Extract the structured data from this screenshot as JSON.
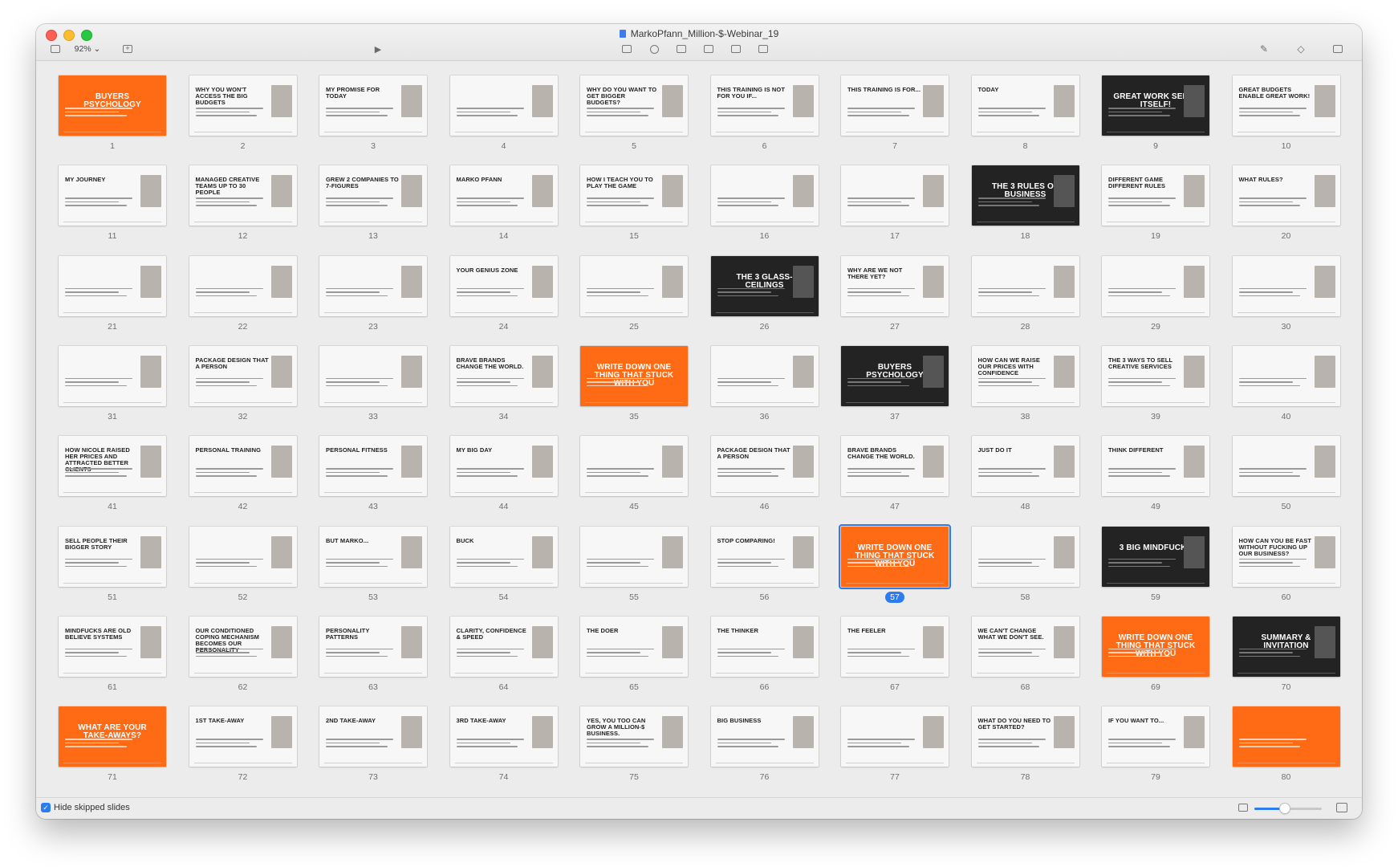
{
  "window": {
    "title": "MarkoPfann_Million-$-Webinar_19",
    "zoom_label": "92% ⌄"
  },
  "bottombar": {
    "hide_skipped_label": "Hide skipped slides",
    "hide_skipped_checked": true,
    "thumb_size_fraction": 0.45
  },
  "selected_slide": 57,
  "slides": [
    {
      "n": "1",
      "style": "orange",
      "title": "BUYERS PSYCHOLOGY"
    },
    {
      "n": "2",
      "style": "light",
      "title": "WHY YOU WON'T ACCESS THE BIG BUDGETS"
    },
    {
      "n": "3",
      "style": "light",
      "title": "MY PROMISE FOR TODAY"
    },
    {
      "n": "4",
      "style": "light",
      "title": ""
    },
    {
      "n": "5",
      "style": "light",
      "title": "WHY DO YOU WANT TO GET BIGGER BUDGETS?"
    },
    {
      "n": "6",
      "style": "light",
      "title": "THIS TRAINING IS NOT FOR YOU IF..."
    },
    {
      "n": "7",
      "style": "light",
      "title": "THIS TRAINING IS FOR..."
    },
    {
      "n": "8",
      "style": "light",
      "title": "TODAY"
    },
    {
      "n": "9",
      "style": "dark",
      "title": "GREAT WORK SELLS ITSELF!"
    },
    {
      "n": "10",
      "style": "light",
      "title": "GREAT BUDGETS ENABLE GREAT WORK!"
    },
    {
      "n": "11",
      "style": "light",
      "title": "MY JOURNEY"
    },
    {
      "n": "12",
      "style": "light",
      "title": "Managed creative teams up to 30 people"
    },
    {
      "n": "13",
      "style": "light",
      "title": "GREW 2 COMPANIES TO 7-FIGURES"
    },
    {
      "n": "14",
      "style": "light",
      "title": "MARKO PFANN"
    },
    {
      "n": "15",
      "style": "light",
      "title": "HOW I TEACH YOU TO PLAY THE GAME"
    },
    {
      "n": "16",
      "style": "light",
      "title": ""
    },
    {
      "n": "17",
      "style": "light",
      "title": ""
    },
    {
      "n": "18",
      "style": "dark",
      "title": "THE 3 RULES OF BUSINESS"
    },
    {
      "n": "19",
      "style": "light",
      "title": "DIFFERENT GAME DIFFERENT RULES"
    },
    {
      "n": "20",
      "style": "light",
      "title": "WHAT RULES?"
    },
    {
      "n": "21",
      "style": "light",
      "title": ""
    },
    {
      "n": "22",
      "style": "light",
      "title": ""
    },
    {
      "n": "23",
      "style": "light",
      "title": ""
    },
    {
      "n": "24",
      "style": "light",
      "title": "YOUR GENIUS ZONE"
    },
    {
      "n": "25",
      "style": "light",
      "title": ""
    },
    {
      "n": "26",
      "style": "dark",
      "title": "THE 3 GLASS-CEILINGS"
    },
    {
      "n": "27",
      "style": "light",
      "title": "WHY ARE WE NOT THERE YET?"
    },
    {
      "n": "28",
      "style": "light",
      "title": ""
    },
    {
      "n": "29",
      "style": "light",
      "title": ""
    },
    {
      "n": "30",
      "style": "light",
      "title": ""
    },
    {
      "n": "31",
      "style": "light",
      "title": ""
    },
    {
      "n": "32",
      "style": "light",
      "title": "Package design that a person"
    },
    {
      "n": "33",
      "style": "light",
      "title": ""
    },
    {
      "n": "34",
      "style": "light",
      "title": "Brave brands change the world."
    },
    {
      "n": "35",
      "style": "orange",
      "title": "WRITE DOWN ONE THING THAT STUCK WITH YOU"
    },
    {
      "n": "36",
      "style": "light",
      "title": ""
    },
    {
      "n": "37",
      "style": "dark",
      "title": "BUYERS PSYCHOLOGY"
    },
    {
      "n": "38",
      "style": "light",
      "title": "HOW CAN WE RAISE OUR PRICES WITH CONFIDENCE"
    },
    {
      "n": "39",
      "style": "light",
      "title": "THE 3 WAYS TO SELL CREATIVE SERVICES"
    },
    {
      "n": "40",
      "style": "light",
      "title": ""
    },
    {
      "n": "41",
      "style": "light",
      "title": "HOW NICOLE RAISED HER PRICES AND ATTRACTED BETTER CLIENTS"
    },
    {
      "n": "42",
      "style": "light",
      "title": "Personal Training"
    },
    {
      "n": "43",
      "style": "light",
      "title": "PERSONAL FITNESS"
    },
    {
      "n": "44",
      "style": "light",
      "title": "MY BIG DAY"
    },
    {
      "n": "45",
      "style": "light",
      "title": ""
    },
    {
      "n": "46",
      "style": "light",
      "title": "Package design that a person"
    },
    {
      "n": "47",
      "style": "light",
      "title": "Brave brands change the world."
    },
    {
      "n": "48",
      "style": "light",
      "title": "JUST DO IT"
    },
    {
      "n": "49",
      "style": "light",
      "title": "THINK DIFFERENT"
    },
    {
      "n": "50",
      "style": "light",
      "title": ""
    },
    {
      "n": "51",
      "style": "light",
      "title": "Sell people their bigger story"
    },
    {
      "n": "52",
      "style": "light",
      "title": ""
    },
    {
      "n": "53",
      "style": "light",
      "title": "BUT MARKO..."
    },
    {
      "n": "54",
      "style": "light",
      "title": "BUCK"
    },
    {
      "n": "55",
      "style": "light",
      "title": ""
    },
    {
      "n": "56",
      "style": "light",
      "title": "STOP COMPARING!"
    },
    {
      "n": "57",
      "style": "orange",
      "title": "WRITE DOWN ONE THING THAT STUCK WITH YOU"
    },
    {
      "n": "58",
      "style": "light",
      "title": ""
    },
    {
      "n": "59",
      "style": "dark",
      "title": "3 BIG MINDFUCKS"
    },
    {
      "n": "60",
      "style": "light",
      "title": "HOW CAN YOU BE FAST WITHOUT FUCKING UP OUR BUSINESS?"
    },
    {
      "n": "61",
      "style": "light",
      "title": "Mindfucks are old believe systems"
    },
    {
      "n": "62",
      "style": "light",
      "title": "OUR CONDITIONED COPING MECHANISM BECOMES OUR PERSONALITY"
    },
    {
      "n": "63",
      "style": "light",
      "title": "PERSONALITY PATTERNS"
    },
    {
      "n": "64",
      "style": "light",
      "title": "CLARITY, CONFIDENCE & SPEED"
    },
    {
      "n": "65",
      "style": "light",
      "title": "THE DOER"
    },
    {
      "n": "66",
      "style": "light",
      "title": "THE THINKER"
    },
    {
      "n": "67",
      "style": "light",
      "title": "THE FEELER"
    },
    {
      "n": "68",
      "style": "light",
      "title": "WE CAN'T CHANGE WHAT WE DON'T SEE."
    },
    {
      "n": "69",
      "style": "orange",
      "title": "WRITE DOWN ONE THING THAT STUCK WITH YOU"
    },
    {
      "n": "70",
      "style": "dark",
      "title": "SUMMARY & INVITATION"
    },
    {
      "n": "71",
      "style": "orange",
      "title": "WHAT ARE YOUR TAKE-AWAYS?"
    },
    {
      "n": "72",
      "style": "light",
      "title": "1ST TAKE-AWAY"
    },
    {
      "n": "73",
      "style": "light",
      "title": "2ND TAKE-AWAY"
    },
    {
      "n": "74",
      "style": "light",
      "title": "3RD TAKE-AWAY"
    },
    {
      "n": "75",
      "style": "light",
      "title": "YES, YOU TOO CAN GROW A MILLION-$ BUSINESS."
    },
    {
      "n": "76",
      "style": "light",
      "title": "Big Business"
    },
    {
      "n": "77",
      "style": "light",
      "title": ""
    },
    {
      "n": "78",
      "style": "light",
      "title": "WHAT DO YOU NEED TO GET STARTED?"
    },
    {
      "n": "79",
      "style": "light",
      "title": "IF YOU WANT TO..."
    },
    {
      "n": "80",
      "style": "orange",
      "title": ""
    }
  ]
}
